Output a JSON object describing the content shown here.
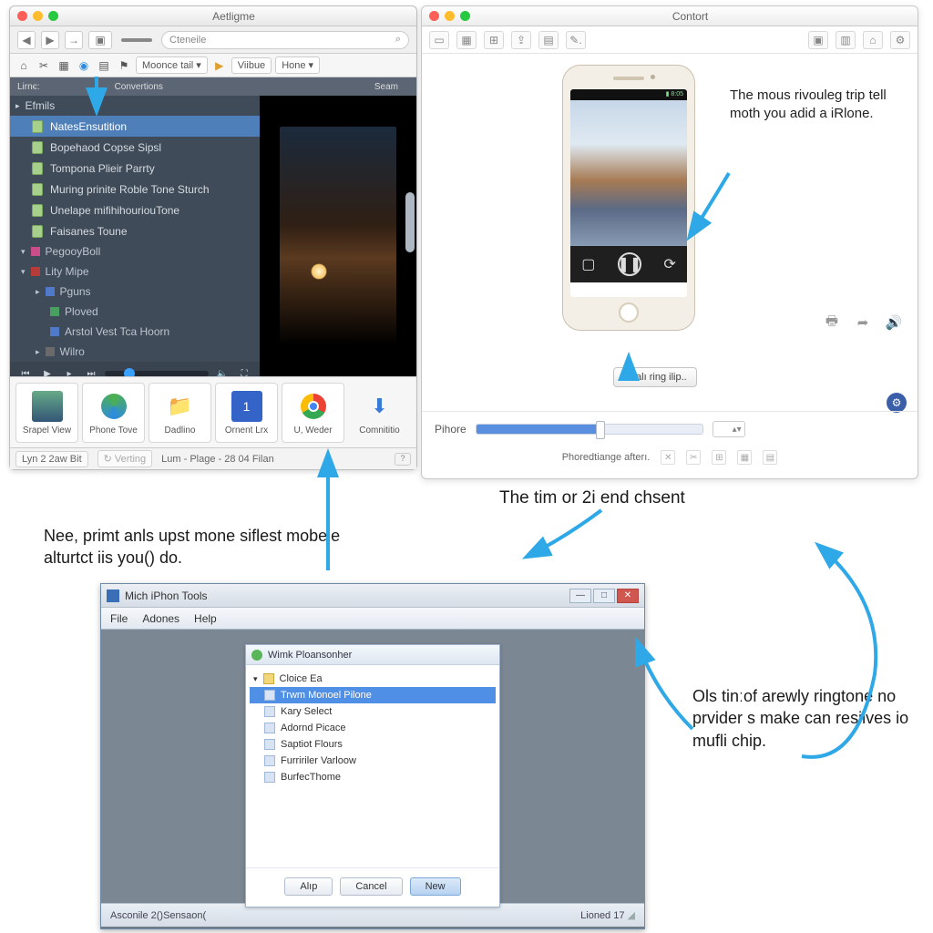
{
  "windowA": {
    "title": "Aetligme",
    "search_placeholder": "Cteneile",
    "nav_icons": [
      "back",
      "fwd",
      "go",
      "camera",
      "slider"
    ],
    "row2": {
      "dropdown1": "Moonce tail",
      "dropdown2": "Viibue",
      "dropdown3": "Hone"
    },
    "row3": {
      "col1": "Lirnє:",
      "col2": "Convertions",
      "col3": "Seam"
    },
    "sidebar_header": "Efmils",
    "sidebar_items": [
      "NatesEnsutition",
      "Bopehaod Copse Sipsl",
      "Tompona Plieir Parrty",
      "Muring prinite Roble Tone Sturch",
      "Unelape mifihihouriouTone",
      "Faisanes Toune"
    ],
    "sidebar_groups": [
      {
        "label": "PegooyBoll",
        "color": "#c94e8a"
      },
      {
        "label": "Lity Mipe",
        "color": "#b63b3b"
      },
      {
        "label": "Pguns",
        "color": "#4e7ac9"
      },
      {
        "label": "Ploved",
        "color": "#48a060"
      },
      {
        "label": "Arstol Vest Tca Hoorn",
        "color": "#4e7ac9"
      },
      {
        "label": "Wilro",
        "color": "#6a6a6a"
      }
    ],
    "tiles": [
      {
        "label": "Srapel View",
        "icon": "photo"
      },
      {
        "label": "Phone Tove",
        "icon": "disc"
      },
      {
        "label": "Dadlino",
        "icon": "folder"
      },
      {
        "label": "Ornent Lrx",
        "icon": "calendar",
        "badge": "1"
      },
      {
        "label": "U, Weder",
        "icon": "chrome"
      },
      {
        "label": "Comnititio",
        "icon": "download"
      }
    ],
    "status_left": "Lyn 2 2aw Bit",
    "status_mid": "Verting",
    "status_right": "Lum - Plage - 28 04 Filan"
  },
  "windowB": {
    "title": "Contort",
    "tip1": "The mous rivouleg trip tell moth you adid a iRlone.",
    "ring_button": "Realı ring ilip..",
    "slider_label": "Pihore",
    "caption": "Phoredtiange afterı.",
    "phone_status": "▮ 8:05"
  },
  "windowC": {
    "title": "Mich iPhon Tools",
    "menu": [
      "File",
      "Adones",
      "Help"
    ],
    "panel_title": "Wimk Ploansonher",
    "tree_root": "Cloice Ea",
    "tree_items": [
      "Trwm Monoel Pilone",
      "Kary Select",
      "Adornd Picace",
      "Saptiot Flours",
      "Furririler Varloow",
      "BurfecThome"
    ],
    "buttons": {
      "aux": "Alıp",
      "cancel": "Cancel",
      "primary": "New"
    },
    "status_left": "Asconile 2()Sensaon(",
    "status_right": "Lioned 17"
  },
  "annotations": {
    "a1": "The tim or 2і end chsent",
    "a2": "Nee, primt anls upst mone siflest mobele alturtct iis you() do.",
    "a3": "Ols tinːof arewly ringtone no prvider s make can resiives io mufli chip."
  }
}
